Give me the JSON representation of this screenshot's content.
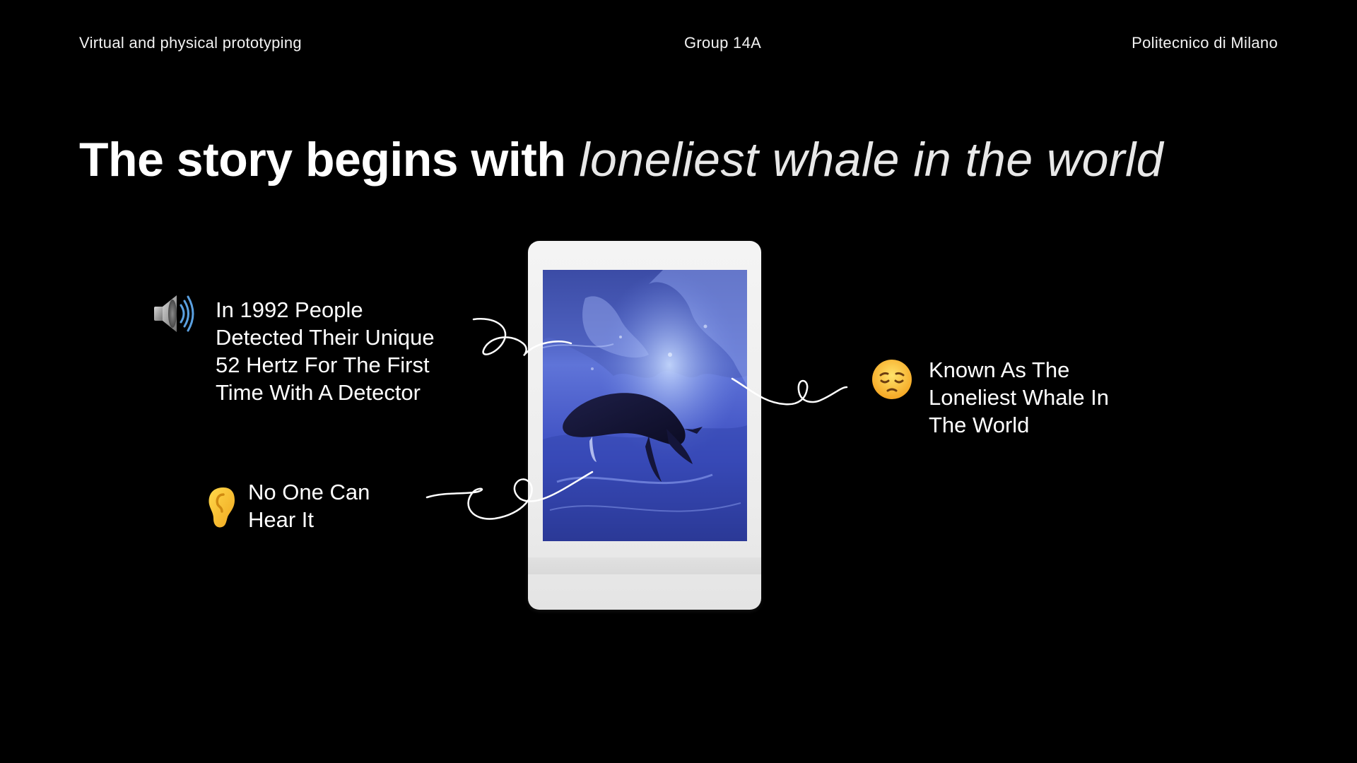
{
  "header": {
    "left": "Virtual and physical prototyping",
    "center": "Group 14A",
    "right": "Politecnico di Milano"
  },
  "title": {
    "bold": "The story begins with",
    "light": "loneliest whale in the world"
  },
  "callouts": [
    {
      "icon": "speaker-icon",
      "lines": [
        "In 1992 People",
        "Detected Their Unique",
        "52 Hertz For The First",
        "Time With A Detector"
      ]
    },
    {
      "icon": "ear-icon",
      "lines": [
        "No One Can",
        "Hear It"
      ]
    },
    {
      "icon": "pensive-face-icon",
      "lines": [
        "Known As The",
        "Loneliest Whale In",
        "The World"
      ]
    }
  ],
  "photo": {
    "subject": "whale-photo"
  },
  "colors": {
    "background": "#000000",
    "text": "#ffffff",
    "photo_blue": "#3a4cc0",
    "polaroid_frame": "#efefef"
  }
}
